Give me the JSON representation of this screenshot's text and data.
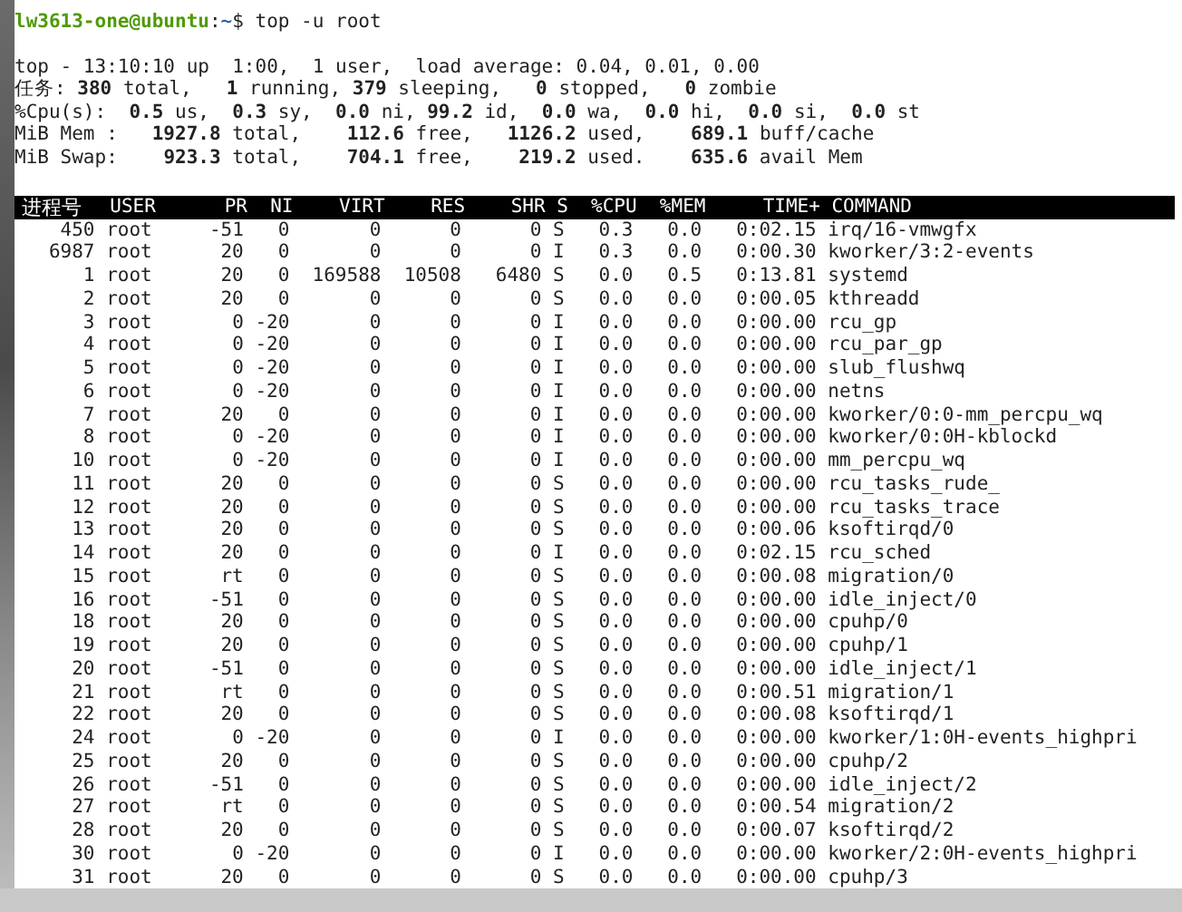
{
  "prompt": {
    "user_host": "lw3613-one@ubuntu",
    "separator": ":",
    "path": "~",
    "command": "$ top -u root"
  },
  "summary": [
    "top - 13:10:10 up  1:00,  1 user,  load average: 0.04, 0.01, 0.00",
    "任务: **380** total,   **1** running, **379** sleeping,   **0** stopped,   **0** zombie",
    "%Cpu(s):  **0.5** us,  **0.3** sy,  **0.0** ni, **99.2** id,  **0.0** wa,  **0.0** hi,  **0.0** si,  **0.0** st",
    "MiB Mem :   **1927.8** total,    **112.6** free,   **1126.2** used,    **689.1** buff/cache",
    "MiB Swap:    **923.3** total,    **704.1** free,    **219.2** used.    **635.6** avail Mem"
  ],
  "table": {
    "columns": [
      "进程号",
      "USER",
      "PR",
      "NI",
      "VIRT",
      "RES",
      "SHR",
      "S",
      "%CPU",
      "%MEM",
      "TIME+",
      "COMMAND"
    ],
    "rows": [
      [
        "450",
        "root",
        "-51",
        "0",
        "0",
        "0",
        "0",
        "S",
        "0.3",
        "0.0",
        "0:02.15",
        "irq/16-vmwgfx"
      ],
      [
        "6987",
        "root",
        "20",
        "0",
        "0",
        "0",
        "0",
        "I",
        "0.3",
        "0.0",
        "0:00.30",
        "kworker/3:2-events"
      ],
      [
        "1",
        "root",
        "20",
        "0",
        "169588",
        "10508",
        "6480",
        "S",
        "0.0",
        "0.5",
        "0:13.81",
        "systemd"
      ],
      [
        "2",
        "root",
        "20",
        "0",
        "0",
        "0",
        "0",
        "S",
        "0.0",
        "0.0",
        "0:00.05",
        "kthreadd"
      ],
      [
        "3",
        "root",
        "0",
        "-20",
        "0",
        "0",
        "0",
        "I",
        "0.0",
        "0.0",
        "0:00.00",
        "rcu_gp"
      ],
      [
        "4",
        "root",
        "0",
        "-20",
        "0",
        "0",
        "0",
        "I",
        "0.0",
        "0.0",
        "0:00.00",
        "rcu_par_gp"
      ],
      [
        "5",
        "root",
        "0",
        "-20",
        "0",
        "0",
        "0",
        "I",
        "0.0",
        "0.0",
        "0:00.00",
        "slub_flushwq"
      ],
      [
        "6",
        "root",
        "0",
        "-20",
        "0",
        "0",
        "0",
        "I",
        "0.0",
        "0.0",
        "0:00.00",
        "netns"
      ],
      [
        "7",
        "root",
        "20",
        "0",
        "0",
        "0",
        "0",
        "I",
        "0.0",
        "0.0",
        "0:00.00",
        "kworker/0:0-mm_percpu_wq"
      ],
      [
        "8",
        "root",
        "0",
        "-20",
        "0",
        "0",
        "0",
        "I",
        "0.0",
        "0.0",
        "0:00.00",
        "kworker/0:0H-kblockd"
      ],
      [
        "10",
        "root",
        "0",
        "-20",
        "0",
        "0",
        "0",
        "I",
        "0.0",
        "0.0",
        "0:00.00",
        "mm_percpu_wq"
      ],
      [
        "11",
        "root",
        "20",
        "0",
        "0",
        "0",
        "0",
        "S",
        "0.0",
        "0.0",
        "0:00.00",
        "rcu_tasks_rude_"
      ],
      [
        "12",
        "root",
        "20",
        "0",
        "0",
        "0",
        "0",
        "S",
        "0.0",
        "0.0",
        "0:00.00",
        "rcu_tasks_trace"
      ],
      [
        "13",
        "root",
        "20",
        "0",
        "0",
        "0",
        "0",
        "S",
        "0.0",
        "0.0",
        "0:00.06",
        "ksoftirqd/0"
      ],
      [
        "14",
        "root",
        "20",
        "0",
        "0",
        "0",
        "0",
        "I",
        "0.0",
        "0.0",
        "0:02.15",
        "rcu_sched"
      ],
      [
        "15",
        "root",
        "rt",
        "0",
        "0",
        "0",
        "0",
        "S",
        "0.0",
        "0.0",
        "0:00.08",
        "migration/0"
      ],
      [
        "16",
        "root",
        "-51",
        "0",
        "0",
        "0",
        "0",
        "S",
        "0.0",
        "0.0",
        "0:00.00",
        "idle_inject/0"
      ],
      [
        "18",
        "root",
        "20",
        "0",
        "0",
        "0",
        "0",
        "S",
        "0.0",
        "0.0",
        "0:00.00",
        "cpuhp/0"
      ],
      [
        "19",
        "root",
        "20",
        "0",
        "0",
        "0",
        "0",
        "S",
        "0.0",
        "0.0",
        "0:00.00",
        "cpuhp/1"
      ],
      [
        "20",
        "root",
        "-51",
        "0",
        "0",
        "0",
        "0",
        "S",
        "0.0",
        "0.0",
        "0:00.00",
        "idle_inject/1"
      ],
      [
        "21",
        "root",
        "rt",
        "0",
        "0",
        "0",
        "0",
        "S",
        "0.0",
        "0.0",
        "0:00.51",
        "migration/1"
      ],
      [
        "22",
        "root",
        "20",
        "0",
        "0",
        "0",
        "0",
        "S",
        "0.0",
        "0.0",
        "0:00.08",
        "ksoftirqd/1"
      ],
      [
        "24",
        "root",
        "0",
        "-20",
        "0",
        "0",
        "0",
        "I",
        "0.0",
        "0.0",
        "0:00.00",
        "kworker/1:0H-events_highpri"
      ],
      [
        "25",
        "root",
        "20",
        "0",
        "0",
        "0",
        "0",
        "S",
        "0.0",
        "0.0",
        "0:00.00",
        "cpuhp/2"
      ],
      [
        "26",
        "root",
        "-51",
        "0",
        "0",
        "0",
        "0",
        "S",
        "0.0",
        "0.0",
        "0:00.00",
        "idle_inject/2"
      ],
      [
        "27",
        "root",
        "rt",
        "0",
        "0",
        "0",
        "0",
        "S",
        "0.0",
        "0.0",
        "0:00.54",
        "migration/2"
      ],
      [
        "28",
        "root",
        "20",
        "0",
        "0",
        "0",
        "0",
        "S",
        "0.0",
        "0.0",
        "0:00.07",
        "ksoftirqd/2"
      ],
      [
        "30",
        "root",
        "0",
        "-20",
        "0",
        "0",
        "0",
        "I",
        "0.0",
        "0.0",
        "0:00.00",
        "kworker/2:0H-events_highpri"
      ],
      [
        "31",
        "root",
        "20",
        "0",
        "0",
        "0",
        "0",
        "S",
        "0.0",
        "0.0",
        "0:00.00",
        "cpuhp/3"
      ]
    ]
  }
}
